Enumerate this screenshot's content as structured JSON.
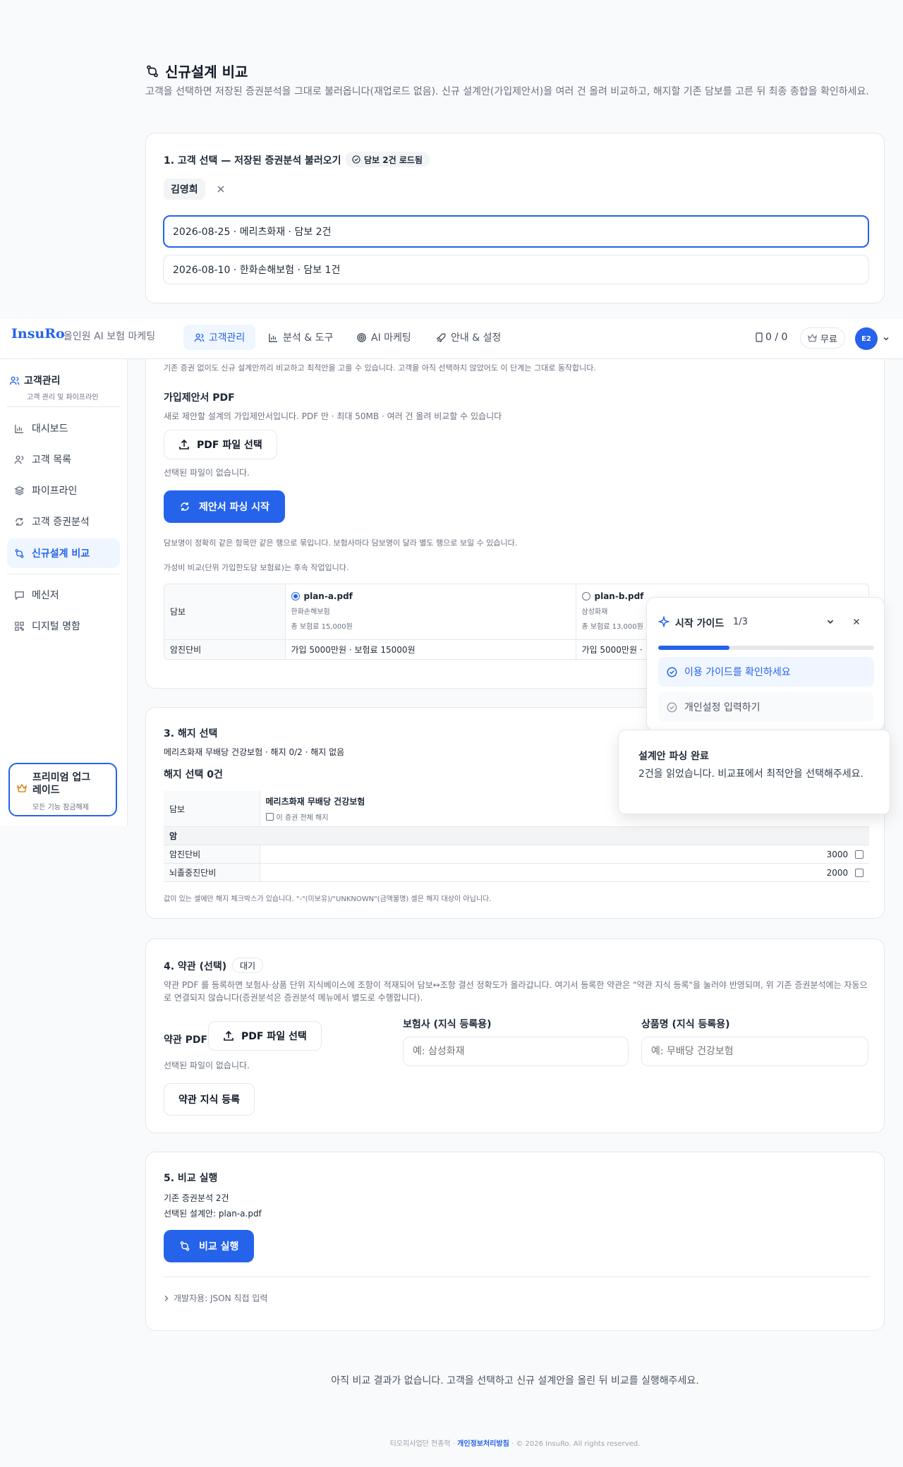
{
  "page": {
    "title": "신규설계 비교",
    "description": "고객을 선택하면 저장된 증권분석을 그대로 불러옵니다(재업로드 없음). 신규 설계안(가입제안서)을 여러 건 올려 비교하고, 해지할 기존 담보를 고른 뒤 최종 종합을 확인하세요."
  },
  "section1": {
    "title": "1. 고객 선택 — 저장된 증권분석 불러오기",
    "badge": "담보 2건 로드됨",
    "customer_name": "김영희",
    "records": [
      "2026-08-25 · 메리츠화재 · 담보 2건",
      "2026-08-10 · 한화손해보험 · 담보 1건"
    ]
  },
  "header": {
    "logo": "InsuRo",
    "subtitle": "올인원 AI 보험 마케팅",
    "tabs": [
      "고객관리",
      "분석 & 도구",
      "AI 마케팅",
      "안내 & 설정"
    ],
    "counter": "0 / 0",
    "plan": "무료",
    "avatar": "E2"
  },
  "sidebar": {
    "title": "고객관리",
    "subtitle": "고객 관리 및 파이프라인",
    "items": [
      "대시보드",
      "고객 목록",
      "파이프라인",
      "고객 증권분석",
      "신규설계 비교",
      "메신저",
      "디지털 명함"
    ],
    "premium_title": "프리미엄 업그레이드",
    "premium_sub": "모든 기능 잠금해제"
  },
  "section2": {
    "intro": "기존 증권 없이도 신규 설계안끼리 비교하고 최적안을 고를 수 있습니다. 고객을 아직 선택하지 않았어도 이 단계는 그대로 동작합니다.",
    "pdf_label": "가입제안서 PDF",
    "pdf_desc": "새로 제안할 설계의 가입제안서입니다. PDF 만 · 최대 50MB · 여러 건 올려 비교할 수 있습니다",
    "file_button": "PDF 파일 선택",
    "no_file": "선택된 파일이 없습니다.",
    "parse_button": "제안서 파싱 시작",
    "note1": "담보명이 정확히 같은 항목만 같은 행으로 묶입니다. 보험사마다 담보명이 달라 별도 행으로 보일 수 있습니다.",
    "note2": "가성비 비교(단위 가입한도당 보험료)는 후속 작업입니다.",
    "table": {
      "head": "담보",
      "plans": [
        {
          "file": "plan-a.pdf",
          "company": "한화손해보험",
          "premium": "총 보험료 15,000원"
        },
        {
          "file": "plan-b.pdf",
          "company": "삼성화재",
          "premium": "총 보험료 13,000원"
        }
      ],
      "row_label": "암진단비",
      "row_values": [
        "가입 5000만원 · 보험료 15000원",
        "가입 5000만원 ·"
      ]
    }
  },
  "guide": {
    "title": "시작 가이드",
    "step": "1/3",
    "progress": 0.33,
    "items": [
      "이용 가이드를 확인하세요",
      "개인설정 입력하기"
    ]
  },
  "toast": {
    "title": "설계안 파싱 완료",
    "body": "2건을 읽었습니다. 비교표에서 최적안을 선택해주세요."
  },
  "section3": {
    "title": "3. 해지 선택",
    "subtitle": "메리츠화재 무배당 건강보험 · 해지 0/2 · 해지 없음",
    "count": "해지 선택 0건",
    "head": "담보",
    "product": "메리츠화재 무배당 건강보험",
    "cancel_all": "이 증권 전체 해지",
    "group": "암",
    "rows": [
      {
        "label": "암진단비",
        "value": "3000"
      },
      {
        "label": "뇌졸중진단비",
        "value": "2000"
      }
    ],
    "note": "값이 있는 셀에만 해지 체크박스가 있습니다. \"-\"(미보유)/\"UNKNOWN\"(금액불명) 셀은 해지 대상이 아닙니다."
  },
  "section4": {
    "title": "4. 약관 (선택)",
    "badge": "대기",
    "desc": "약관 PDF 를 등록하면 보험사·상품 단위 지식베이스에 조항이 적재되어 담보↔조항 결선 정확도가 올라갑니다. 여기서 등록한 약관은 \"약관 지식 등록\"을 눌러야 반영되며, 위 기존 증권분석에는 자동으로 연결되지 않습니다(증권분석은 증권분석 메뉴에서 별도로 수행합니다).",
    "pdf_label": "약관 PDF",
    "file_button": "PDF 파일 선택",
    "no_file": "선택된 파일이 없습니다.",
    "register_button": "약관 지식 등록",
    "insurer_label": "보험사 (지식 등록용)",
    "insurer_placeholder": "예: 삼성화재",
    "product_label": "상품명 (지식 등록용)",
    "product_placeholder": "예: 무배당 건강보험"
  },
  "section5": {
    "title": "5. 비교 실행",
    "line1": "기존 증권분석 2건",
    "line2": "선택된 설계안: plan-a.pdf",
    "run_button": "비교 실행",
    "dev": "개발자용: JSON 직접 입력"
  },
  "empty_state": "아직 비교 결과가 없습니다. 고객을 선택하고 신규 설계안을 올린 뒤 비교를 실행해주세요.",
  "footer": {
    "company": "티오피사업단 전종혁 · ",
    "privacy": "개인정보처리방침",
    "copyright": " · © 2026 InsuRo. All rights reserved."
  },
  "colors": {
    "primary": "#2563eb",
    "border": "#e5e7eb",
    "muted": "#6b7280"
  }
}
